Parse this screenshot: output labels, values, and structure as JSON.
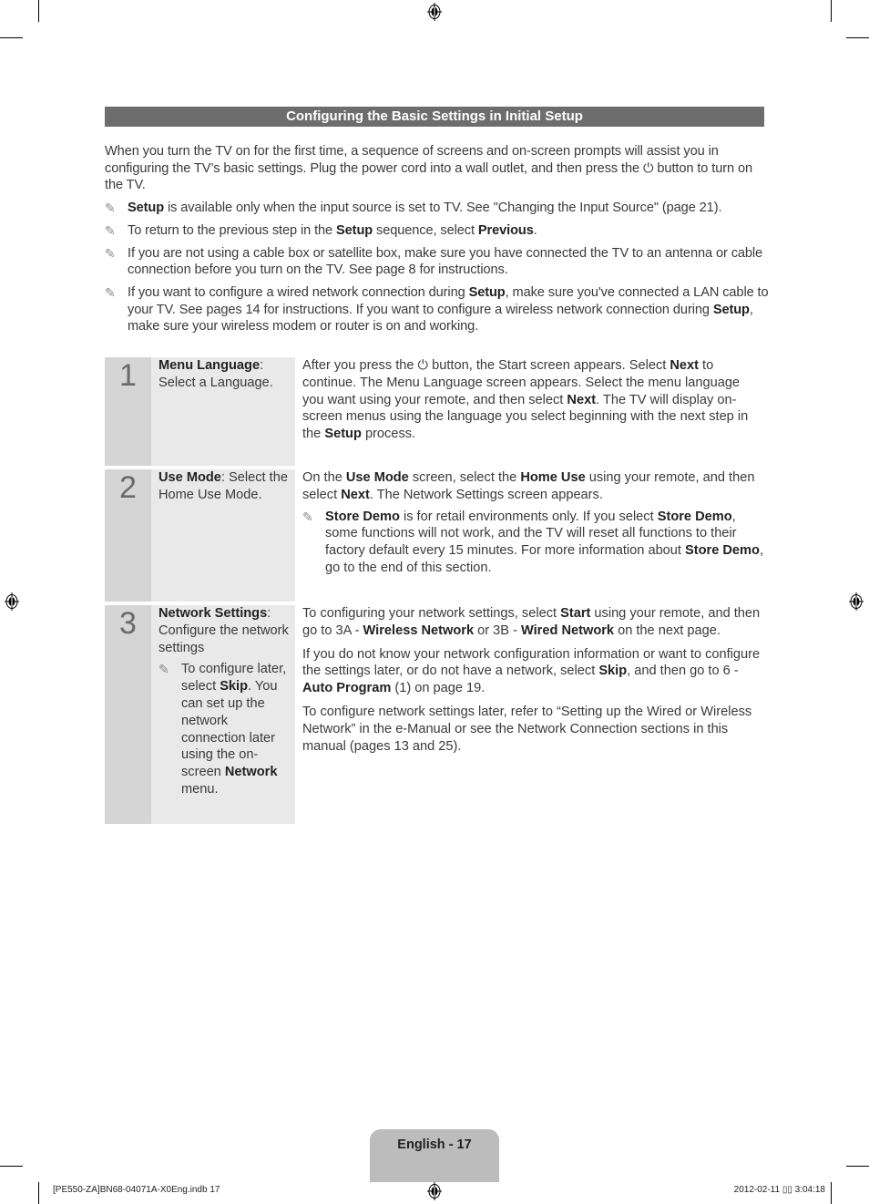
{
  "page": {
    "title": "Configuring the Basic Settings in Initial Setup",
    "intro": {
      "pre": "When you turn the TV on for the first time, a sequence of screens and on-screen prompts will assist you in configuring the TV’s basic settings. Plug the power cord into a wall outlet, and then press the ",
      "power_icon": "⏻",
      "post": " button to turn on the TV."
    },
    "notes": [
      {
        "segments": [
          {
            "t": "Setup",
            "b": true
          },
          {
            "t": " is available only when the input source is set to TV. See \"Changing the Input Source\" (page 21).",
            "b": false
          }
        ]
      },
      {
        "segments": [
          {
            "t": "To return to the previous step in the ",
            "b": false
          },
          {
            "t": "Setup",
            "b": true
          },
          {
            "t": " sequence, select ",
            "b": false
          },
          {
            "t": "Previous",
            "b": true
          },
          {
            "t": ".",
            "b": false
          }
        ]
      },
      {
        "segments": [
          {
            "t": "If you are not using a cable box or satellite box, make sure you have connected the TV to an antenna or cable connection before you turn on the TV. See page 8 for instructions.",
            "b": false
          }
        ]
      },
      {
        "segments": [
          {
            "t": "If you want to configure a wired network connection during ",
            "b": false
          },
          {
            "t": "Setup",
            "b": true
          },
          {
            "t": ", make sure you've connected a LAN cable to your TV. See pages 14 for instructions. If you want to configure a wireless network connection during ",
            "b": false
          },
          {
            "t": "Setup",
            "b": true
          },
          {
            "t": ", make sure your wireless modem or router is on and working.",
            "b": false
          }
        ]
      }
    ],
    "steps": [
      {
        "number": "1",
        "label": [
          {
            "t": "Menu Language",
            "b": true
          },
          {
            "t": ": Select a Language.",
            "b": false
          }
        ],
        "label_note": null,
        "paragraphs": [
          [
            {
              "t": "After you press the ⏻ button, the Start screen appears. Select ",
              "b": false
            },
            {
              "t": "Next",
              "b": true
            },
            {
              "t": " to continue. The Menu Language screen appears. Select the menu language you want using your remote, and then select ",
              "b": false
            },
            {
              "t": "Next",
              "b": true
            },
            {
              "t": ". The TV will display on-screen menus using the language you select beginning with the next step in the ",
              "b": false
            },
            {
              "t": "Setup",
              "b": true
            },
            {
              "t": " process.",
              "b": false
            }
          ]
        ],
        "desc_note": null
      },
      {
        "number": "2",
        "label": [
          {
            "t": "Use Mode",
            "b": true
          },
          {
            "t": ": Select the Home Use Mode.",
            "b": false
          }
        ],
        "label_note": null,
        "paragraphs": [
          [
            {
              "t": "On the ",
              "b": false
            },
            {
              "t": "Use Mode",
              "b": true
            },
            {
              "t": " screen, select the ",
              "b": false
            },
            {
              "t": "Home Use",
              "b": true
            },
            {
              "t": " using your remote, and then select ",
              "b": false
            },
            {
              "t": "Next",
              "b": true
            },
            {
              "t": ". The Network Settings screen appears.",
              "b": false
            }
          ]
        ],
        "desc_note": [
          {
            "t": "Store Demo",
            "b": true
          },
          {
            "t": " is for retail environments only. If you select ",
            "b": false
          },
          {
            "t": "Store Demo",
            "b": true
          },
          {
            "t": ", some functions will not work, and the TV will reset all functions to their factory default every 15 minutes. For more information about ",
            "b": false
          },
          {
            "t": "Store Demo",
            "b": true
          },
          {
            "t": ", go to the end of this section.",
            "b": false
          }
        ]
      },
      {
        "number": "3",
        "label": [
          {
            "t": "Network Settings",
            "b": true
          },
          {
            "t": ": Configure the network settings",
            "b": false
          }
        ],
        "label_note": [
          {
            "t": "To configure later, select ",
            "b": false
          },
          {
            "t": "Skip",
            "b": true
          },
          {
            "t": ". You can set up the network connection later using the on-screen ",
            "b": false
          },
          {
            "t": "Network",
            "b": true
          },
          {
            "t": " menu.",
            "b": false
          }
        ],
        "paragraphs": [
          [
            {
              "t": "To configuring your network settings, select ",
              "b": false
            },
            {
              "t": "Start",
              "b": true
            },
            {
              "t": " using your remote, and then go to 3A - ",
              "b": false
            },
            {
              "t": "Wireless Network",
              "b": true
            },
            {
              "t": " or 3B - ",
              "b": false
            },
            {
              "t": "Wired Network",
              "b": true
            },
            {
              "t": " on the next page.",
              "b": false
            }
          ],
          [
            {
              "t": "If you do not know your network configuration information or want to configure the settings later, or do not have a network, select ",
              "b": false
            },
            {
              "t": "Skip",
              "b": true
            },
            {
              "t": ", and then go to 6 - ",
              "b": false
            },
            {
              "t": "Auto Program",
              "b": true
            },
            {
              "t": " (1) on page 19.",
              "b": false
            }
          ],
          [
            {
              "t": "To configure network settings later, refer to “Setting up the Wired or Wireless Network” in the e-Manual or see the Network Connection sections in this manual (pages 13 and 25).",
              "b": false
            }
          ]
        ],
        "desc_note": null
      }
    ],
    "note_icon": "✎",
    "footer": {
      "page_label": "English - 17",
      "slug_left": "[PE550-ZA]BN68-04071A-X0Eng.indb   17",
      "slug_right": "2012-02-11   ▯▯ 3:04:18"
    }
  }
}
